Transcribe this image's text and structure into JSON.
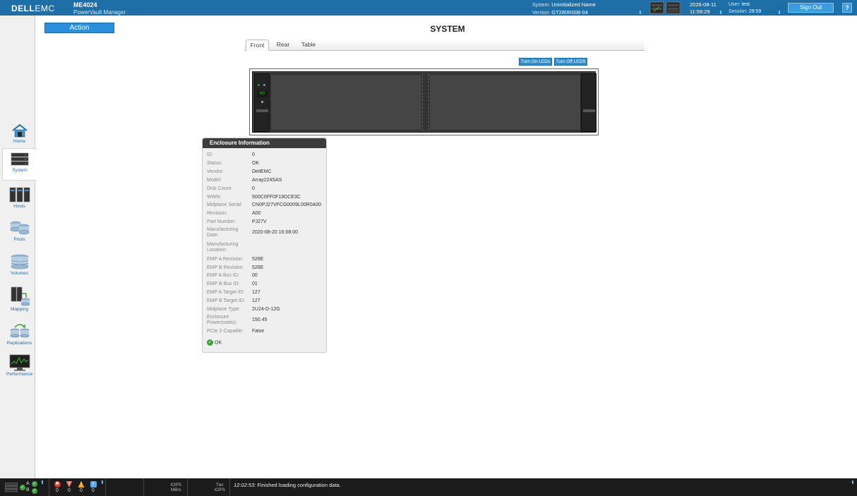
{
  "header": {
    "brand_bold": "DELL",
    "brand_thin": "EMC",
    "product_name": "ME4024",
    "product_sub": "PowerVault Manager",
    "system_label": "System:",
    "system_value": "Uninitialized Name",
    "version_label": "Version:",
    "version_value": "GT280R008-04",
    "date": "2026-08-11",
    "time": "11:59:29",
    "user_label": "User:",
    "user_value": "test",
    "session_label": "Session:",
    "session_value": "29:59",
    "signout_label": "Sign Out",
    "help_label": "?"
  },
  "sidebar": {
    "items": [
      {
        "label": "Home",
        "icon": "home-icon"
      },
      {
        "label": "System",
        "icon": "system-icon"
      },
      {
        "label": "Hosts",
        "icon": "hosts-icon"
      },
      {
        "label": "Pools",
        "icon": "pools-icon"
      },
      {
        "label": "Volumes",
        "icon": "volumes-icon"
      },
      {
        "label": "Mapping",
        "icon": "mapping-icon"
      },
      {
        "label": "Replications",
        "icon": "replications-icon"
      },
      {
        "label": "Performance",
        "icon": "performance-icon"
      }
    ],
    "active": "System"
  },
  "main": {
    "action_label": "Action",
    "title": "SYSTEM",
    "tabs": [
      {
        "label": "Front",
        "active": true
      },
      {
        "label": "Rear",
        "active": false
      },
      {
        "label": "Table",
        "active": false
      }
    ],
    "led_on_label": "Turn On LEDs",
    "led_off_label": "Turn Off LEDS",
    "enclosure_display": "00"
  },
  "enclosure_info": {
    "title": "Enclosure Information",
    "rows": [
      {
        "key": "ID:",
        "value": "0"
      },
      {
        "key": "Status:",
        "value": "OK"
      },
      {
        "key": "Vendor:",
        "value": "DellEMC"
      },
      {
        "key": "Model:",
        "value": "Array224SAS"
      },
      {
        "key": "Disk Count:",
        "value": "0"
      },
      {
        "key": "WWN:",
        "value": "500C0FF0F19DCE3C"
      },
      {
        "key": "Midplane Serial:",
        "value": "CN0PJ27VFCG0009L00R0A00"
      },
      {
        "key": "Revision:",
        "value": "A00"
      },
      {
        "key": "Part Number:",
        "value": "PJ27V"
      },
      {
        "key": "Manufacturing Date:",
        "value": "2020-08-20 16:08:00"
      },
      {
        "key": "Manufacturing Location:",
        "value": ""
      },
      {
        "key": "EMP A Revision:",
        "value": "526E"
      },
      {
        "key": "EMP B Revision:",
        "value": "526E"
      },
      {
        "key": "EMP A Bus ID:",
        "value": "00"
      },
      {
        "key": "EMP B Bus ID:",
        "value": "01"
      },
      {
        "key": "EMP A Target ID:",
        "value": "127"
      },
      {
        "key": "EMP B Target ID:",
        "value": "127"
      },
      {
        "key": "Midplane Type:",
        "value": "2U24-D-12G"
      },
      {
        "key": "Enclosure Power(watts):",
        "value": "150.45"
      },
      {
        "key": "PCIe 2-Capable:",
        "value": "False"
      }
    ],
    "health": "OK"
  },
  "statusbar": {
    "controller_a": "A",
    "controller_b": "B",
    "alerts": [
      {
        "type": "critical",
        "count": "0",
        "color": "#e53935"
      },
      {
        "type": "error",
        "count": "0",
        "color": "#e57373"
      },
      {
        "type": "warning",
        "count": "0",
        "color": "#f5a623"
      },
      {
        "type": "info",
        "count": "0",
        "color": "#5aa9e6"
      }
    ],
    "iops_label": "IOPS",
    "mbs_label": "MB/s",
    "tier_label": "Tier",
    "tier_iops_label": "IOPS",
    "message_time": "12:02:53:",
    "message_text": "Finished loading configuration data."
  }
}
